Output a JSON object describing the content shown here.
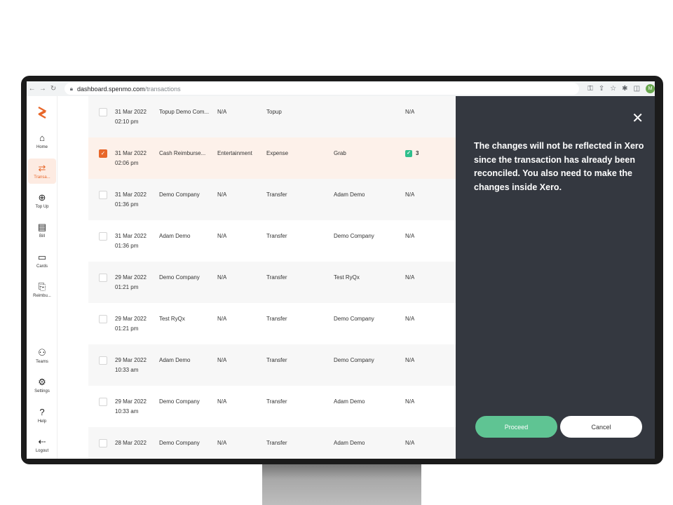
{
  "browser": {
    "host": "dashboard.spenmo.com",
    "path": "/transactions",
    "profile_initial": "M"
  },
  "sidebar": {
    "items": [
      {
        "label": "Home",
        "icon": "home-icon"
      },
      {
        "label": "Transa...",
        "icon": "transfer-icon",
        "active": true
      },
      {
        "label": "Top Up",
        "icon": "topup-icon"
      },
      {
        "label": "Bill",
        "icon": "bill-icon"
      },
      {
        "label": "Cards",
        "icon": "card-icon"
      },
      {
        "label": "Reimbu...",
        "icon": "reimbursement-icon"
      },
      {
        "label": "Teams",
        "icon": "team-icon"
      },
      {
        "label": "Settings",
        "icon": "gear-icon"
      },
      {
        "label": "Help",
        "icon": "help-icon"
      },
      {
        "label": "Logout",
        "icon": "logout-icon"
      }
    ]
  },
  "transactions": [
    {
      "date": "31 Mar 2022",
      "time": "02:10 pm",
      "name": "Topup Demo Com...",
      "category": "N/A",
      "type": "Topup",
      "party": "",
      "extra": "N/A"
    },
    {
      "date": "31 Mar 2022",
      "time": "02:06 pm",
      "name": "Cash Reimburse...",
      "category": "Entertainment",
      "type": "Expense",
      "party": "Grab",
      "extra": "3",
      "checked": true
    },
    {
      "date": "31 Mar 2022",
      "time": "01:36 pm",
      "name": "Demo Company",
      "category": "N/A",
      "type": "Transfer",
      "party": "Adam Demo",
      "extra": "N/A"
    },
    {
      "date": "31 Mar 2022",
      "time": "01:36 pm",
      "name": "Adam Demo",
      "category": "N/A",
      "type": "Transfer",
      "party": "Demo Company",
      "extra": "N/A"
    },
    {
      "date": "29 Mar 2022",
      "time": "01:21 pm",
      "name": "Demo Company",
      "category": "N/A",
      "type": "Transfer",
      "party": "Test RyQx",
      "extra": "N/A"
    },
    {
      "date": "29 Mar 2022",
      "time": "01:21 pm",
      "name": "Test RyQx",
      "category": "N/A",
      "type": "Transfer",
      "party": "Demo Company",
      "extra": "N/A"
    },
    {
      "date": "29 Mar 2022",
      "time": "10:33 am",
      "name": "Adam Demo",
      "category": "N/A",
      "type": "Transfer",
      "party": "Demo Company",
      "extra": "N/A"
    },
    {
      "date": "29 Mar 2022",
      "time": "10:33 am",
      "name": "Demo Company",
      "category": "N/A",
      "type": "Transfer",
      "party": "Adam Demo",
      "extra": "N/A"
    },
    {
      "date": "28 Mar 2022",
      "time": "",
      "name": "Demo Company",
      "category": "N/A",
      "type": "Transfer",
      "party": "Adam Demo",
      "extra": "N/A"
    }
  ],
  "panel": {
    "message": "The changes will not be reflected in Xero since the transaction has already been reconciled. You also need to make the changes inside Xero.",
    "proceed_label": "Proceed",
    "cancel_label": "Cancel"
  },
  "colors": {
    "accent": "#e8672a",
    "panel_bg": "#343840",
    "proceed": "#5fc493"
  }
}
